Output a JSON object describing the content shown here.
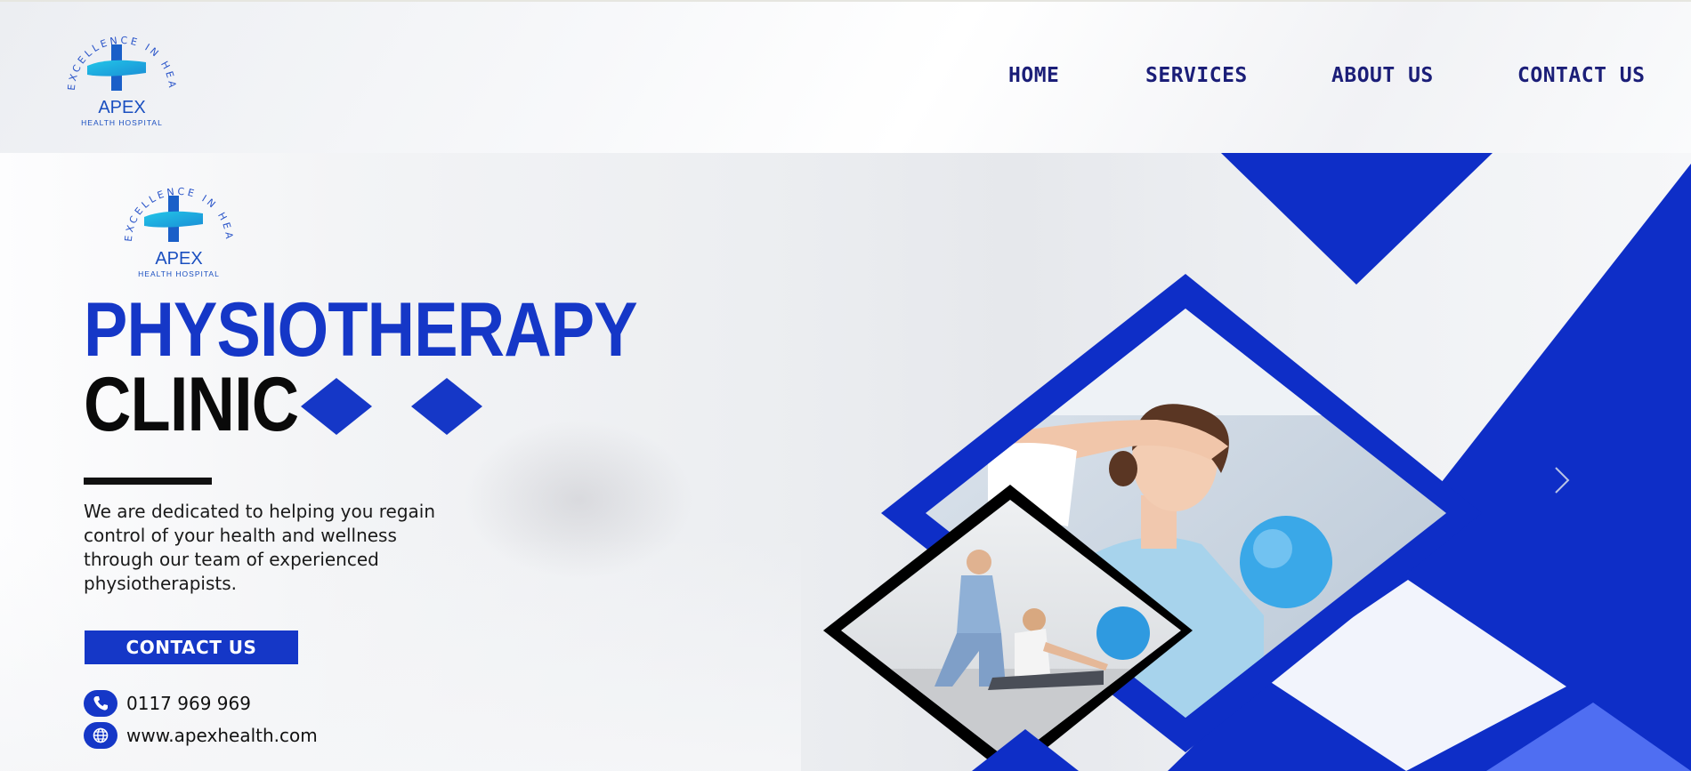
{
  "brand": {
    "ring_text": "EXCELLENCE IN HEALTHCARE",
    "name": "APEX",
    "sub": "HEALTH HOSPITAL"
  },
  "nav": {
    "items": [
      {
        "label": "HOME"
      },
      {
        "label": "SERVICES"
      },
      {
        "label": "ABOUT US"
      },
      {
        "label": "CONTACT US"
      }
    ]
  },
  "hero": {
    "title_line1": "PHYSIOTHERAPY",
    "title_line2": "CLINIC",
    "tagline": "We are dedicated to helping you regain control of your health and wellness through our team of experienced physiotherapists.",
    "cta_label": "CONTACT US",
    "phone": "0117 969 969",
    "website": "www.apexhealth.com",
    "phone_icon": "phone-icon",
    "web_icon": "globe-icon",
    "next_icon": "chevron-right-icon"
  },
  "colors": {
    "brand_blue": "#1537c7",
    "nav_text": "#1b1e78",
    "logo_teal": "#1fb8e0",
    "light_blue": "#4f6ef2"
  }
}
